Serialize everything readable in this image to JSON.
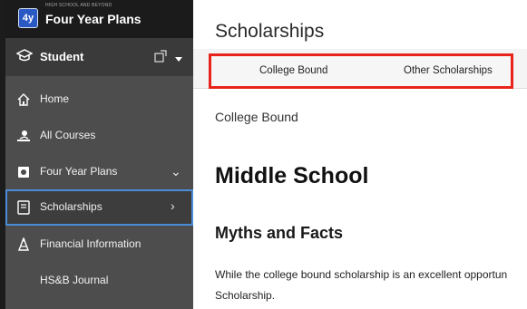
{
  "brand": {
    "logo": "4y",
    "small_text": "HIGH SCHOOL AND BEYOND",
    "title": "Four Year Plans"
  },
  "student": {
    "label": "Student",
    "icon": "graduation-cap-icon"
  },
  "nav": [
    {
      "label": "Home",
      "icon": "home-icon"
    },
    {
      "label": "All Courses",
      "icon": "courses-icon"
    },
    {
      "label": "Four Year Plans",
      "icon": "plans-icon",
      "chevron": "⌄"
    },
    {
      "label": "Scholarships",
      "icon": "book-icon",
      "chevron": "›"
    },
    {
      "label": "Financial Information",
      "icon": "financial-icon"
    },
    {
      "label": "HS&B Journal",
      "icon": ""
    }
  ],
  "main": {
    "title": "Scholarships",
    "tabs": [
      "College Bound",
      "Other Scholarships"
    ],
    "section": "College Bound",
    "h1": "Middle School",
    "h2": "Myths and Facts",
    "para1": "While the college bound scholarship is an excellent opportun",
    "para2": "Scholarship."
  },
  "colors": {
    "sidebar": "#4d4d4d",
    "accent_red": "#e8231b",
    "active_border": "#4a8cd9"
  }
}
